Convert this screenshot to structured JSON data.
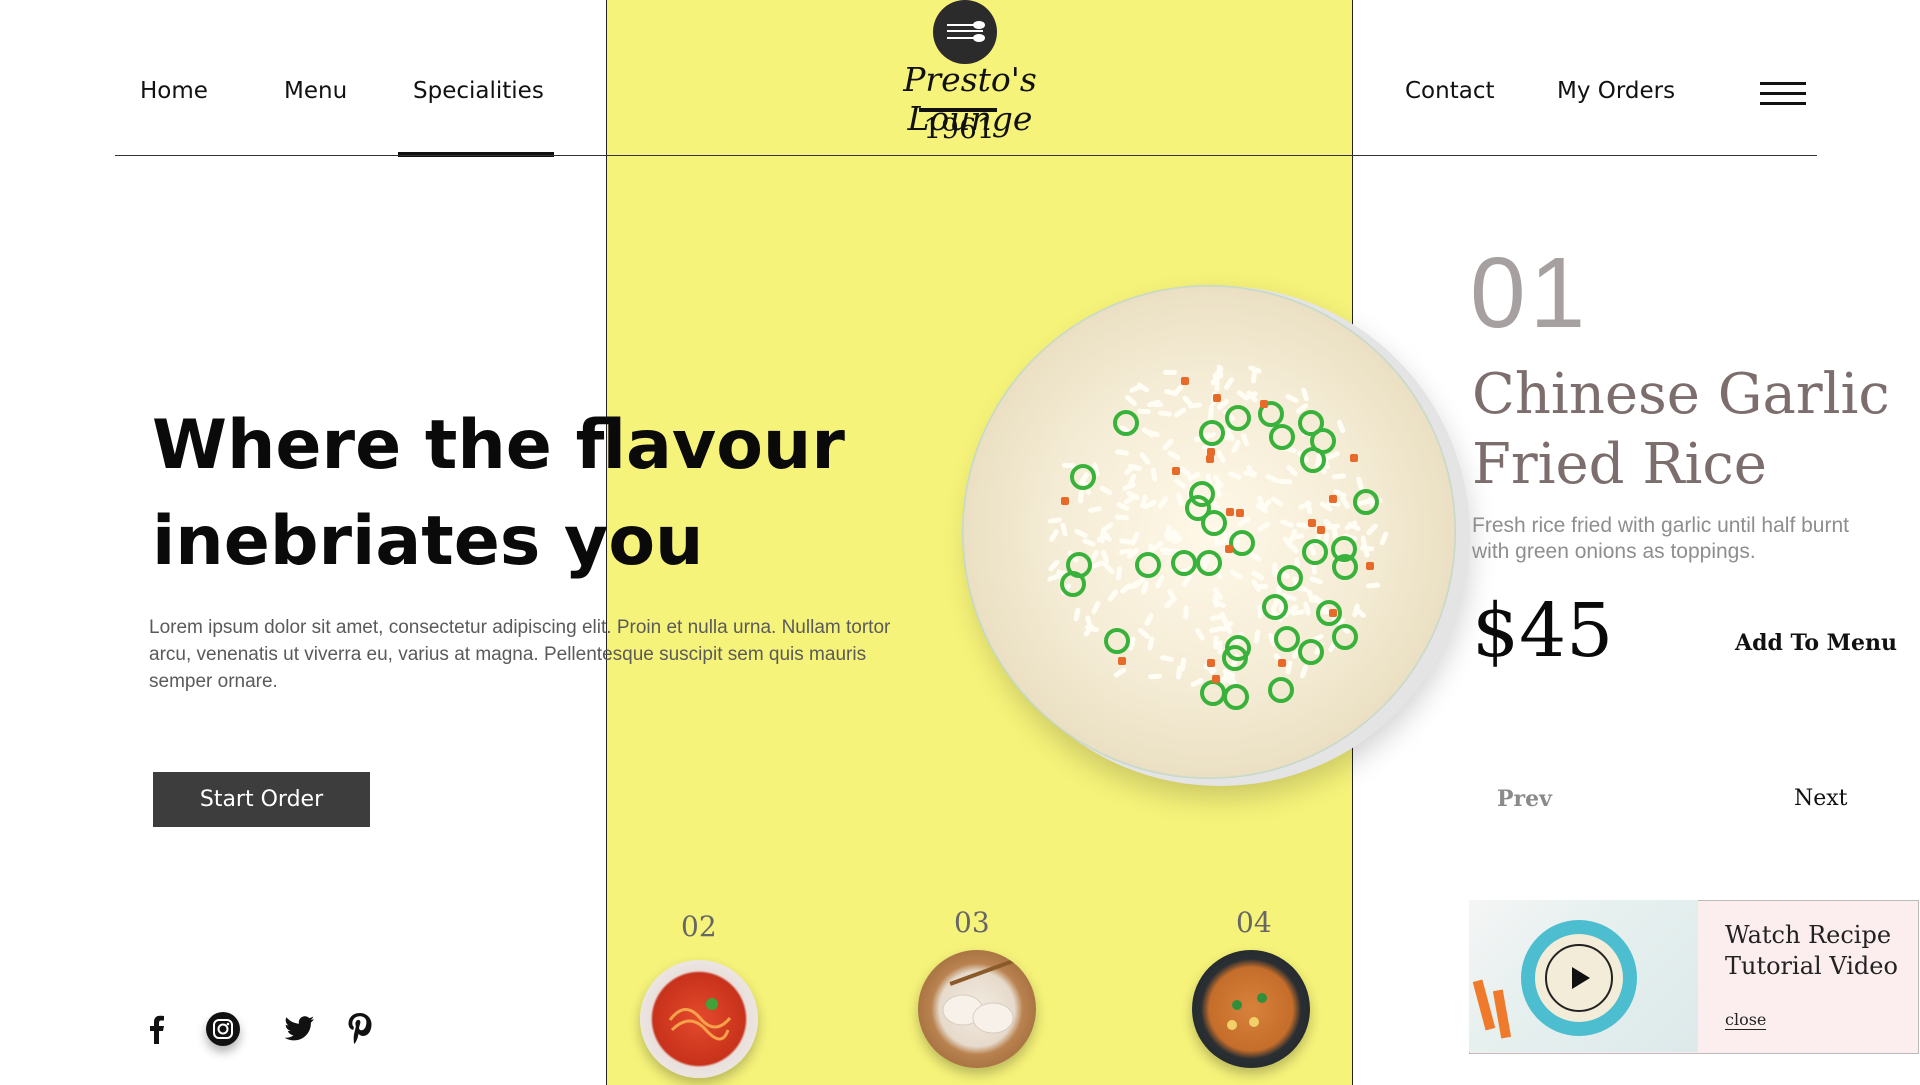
{
  "nav": {
    "left": [
      {
        "label": "Home"
      },
      {
        "label": "Menu"
      },
      {
        "label": "Specialities"
      }
    ],
    "right": [
      {
        "label": "Contact"
      },
      {
        "label": "My Orders"
      }
    ],
    "active": "Specialities"
  },
  "logo": {
    "name": "Presto's Lounge",
    "year": "1961",
    "icon": "cutlery-icon"
  },
  "hero": {
    "title_line1": "Where the flavour",
    "title_line2": "inebriates you",
    "body": "Lorem ipsum dolor sit amet, consectetur adipiscing elit. Proin et nulla urna. Nullam tortor arcu, venenatis ut viverra eu, varius at magna. Pellentesque suscipit sem quis mauris semper ornare.",
    "cta": "Start Order"
  },
  "featured": {
    "index": "01",
    "name_line1": "Chinese Garlic",
    "name_line2": "Fried Rice",
    "description": "Fresh rice fried with garlic until half burnt with green onions as toppings.",
    "price": "$45",
    "add_label": "Add To Menu",
    "prev_label": "Prev",
    "next_label": "Next"
  },
  "thumbnails": [
    {
      "number": "02",
      "dish_icon": "spaghetti-icon"
    },
    {
      "number": "03",
      "dish_icon": "dumplings-icon"
    },
    {
      "number": "04",
      "dish_icon": "stir-fry-icon"
    }
  ],
  "video": {
    "title_line1": "Watch Recipe",
    "title_line2": "Tutorial Video",
    "close_label": "close",
    "icon": "play-icon"
  },
  "social": [
    "facebook-icon",
    "instagram-icon",
    "twitter-icon",
    "pinterest-icon"
  ],
  "colors": {
    "accent_yellow": "#f6f37a",
    "button_dark": "#3d3d3d",
    "title_muted": "#7d6e6e"
  }
}
